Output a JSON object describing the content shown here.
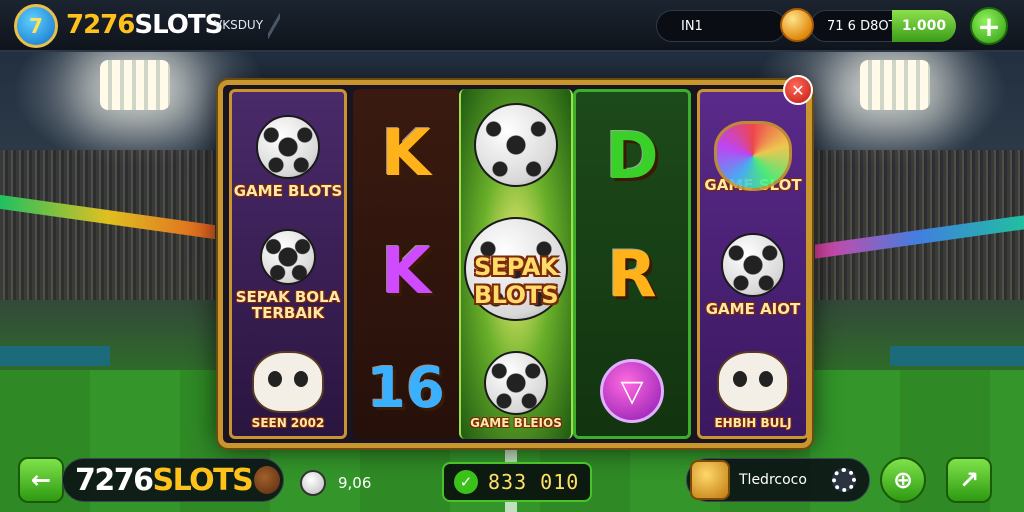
{
  "header": {
    "logo_glyph": "7",
    "brand_number": "7276",
    "brand_text": "SLOTS",
    "tagline": "VKSDUY",
    "info_label": "IN1",
    "balance_text": "7​1 6 D8OT",
    "balance_value": "1.000",
    "add_label": "+"
  },
  "reels": [
    {
      "top_label": "GAME BLOTS",
      "top_sub": "",
      "mid_label": "SEPAK BOLA TERBAIK",
      "bottom_label": "SEEN 2002"
    },
    {
      "top_letter": "K",
      "mid_letter": "K",
      "bottom_letter": "16",
      "top_color": "#ffb21a",
      "mid_color": "#d04aff",
      "bottom_color": "#3ab0ff"
    },
    {
      "mid_title": "SEPAK BLOTS",
      "bottom_label": "GAME BLEIOS"
    },
    {
      "top_letter": "D",
      "mid_letter": "R",
      "top_color": "#3ad02a",
      "mid_color": "#ffb21a",
      "bottom_icon": "▽"
    },
    {
      "top_label": "GAME SLOT",
      "mid_label": "GAME AIOT",
      "bottom_label": "EHBIH BULJ"
    }
  ],
  "controls": {
    "close_label": "✕",
    "back_label": "←",
    "footer_brand_number": "7276",
    "footer_brand_text": "SLOTS",
    "bet_value": "9,06",
    "win_check": "✓",
    "win_value": "833 010",
    "user_label": "Tledrcoco",
    "grid_label": "⊕",
    "chart_label": "↗"
  },
  "colors": {
    "accent_gold": "#c9962e",
    "accent_green": "#3ab02a",
    "brand_yellow": "#ffc21d"
  }
}
